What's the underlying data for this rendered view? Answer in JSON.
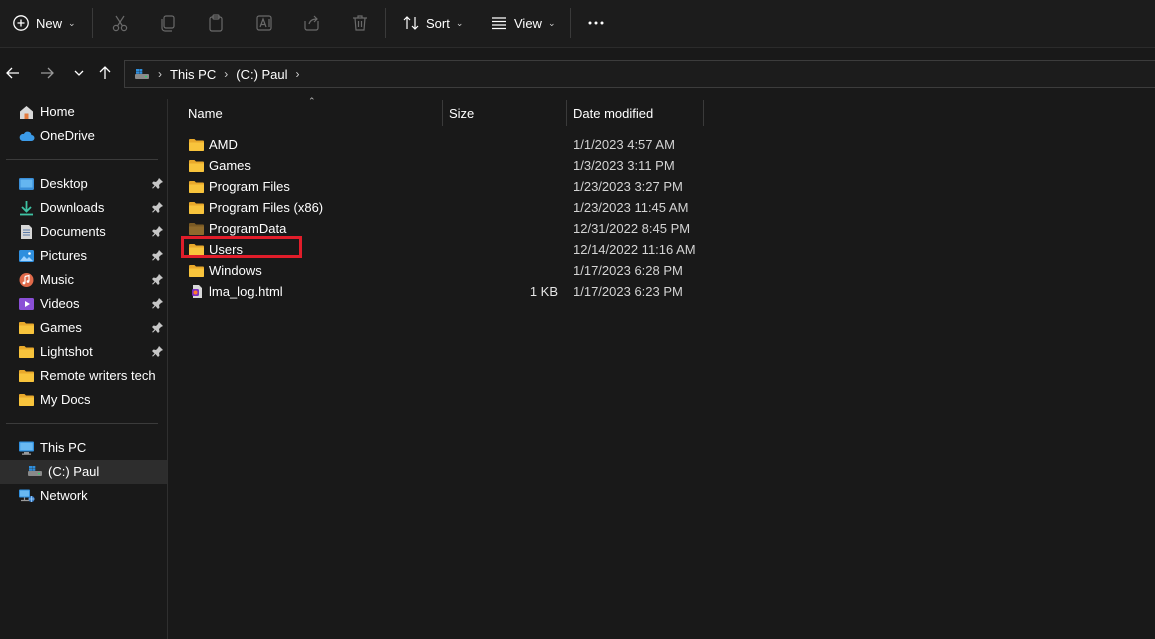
{
  "toolbar": {
    "new_label": "New",
    "sort_label": "Sort",
    "view_label": "View",
    "icons": [
      "new-icon",
      "cut-icon",
      "copy-icon",
      "paste-icon",
      "rename-icon",
      "share-icon",
      "delete-icon",
      "sort-icon",
      "view-icon",
      "more-icon"
    ]
  },
  "address": {
    "crumbs": [
      "This PC",
      "(C:) Paul"
    ]
  },
  "sidebar": {
    "items": [
      {
        "label": "Home",
        "icon": "home-icon"
      },
      {
        "label": "OneDrive",
        "icon": "cloud-icon"
      },
      {
        "label": "Desktop",
        "icon": "desktop-icon"
      },
      {
        "label": "Downloads",
        "icon": "download-icon"
      },
      {
        "label": "Documents",
        "icon": "document-icon"
      },
      {
        "label": "Pictures",
        "icon": "pictures-icon"
      },
      {
        "label": "Music",
        "icon": "music-icon"
      },
      {
        "label": "Videos",
        "icon": "videos-icon"
      },
      {
        "label": "Games",
        "icon": "folder-icon"
      },
      {
        "label": "Lightshot",
        "icon": "folder-icon"
      },
      {
        "label": "Remote writers tech",
        "icon": "folder-icon"
      },
      {
        "label": "My Docs",
        "icon": "folder-icon"
      },
      {
        "label": "This PC",
        "icon": "computer-icon"
      },
      {
        "label": "(C:) Paul",
        "icon": "drive-icon"
      },
      {
        "label": "Network",
        "icon": "network-icon"
      }
    ]
  },
  "columns": {
    "name": "Name",
    "size": "Size",
    "date": "Date modified"
  },
  "files": [
    {
      "name": "AMD",
      "size": "",
      "date": "1/1/2023 4:57 AM",
      "type": "folder"
    },
    {
      "name": "Games",
      "size": "",
      "date": "1/3/2023 3:11 PM",
      "type": "folder"
    },
    {
      "name": "Program Files",
      "size": "",
      "date": "1/23/2023 3:27 PM",
      "type": "folder"
    },
    {
      "name": "Program Files (x86)",
      "size": "",
      "date": "1/23/2023 11:45 AM",
      "type": "folder"
    },
    {
      "name": "ProgramData",
      "size": "",
      "date": "12/31/2022 8:45 PM",
      "type": "folder-hidden"
    },
    {
      "name": "Users",
      "size": "",
      "date": "12/14/2022 11:16 AM",
      "type": "folder"
    },
    {
      "name": "Windows",
      "size": "",
      "date": "1/17/2023 6:28 PM",
      "type": "folder"
    },
    {
      "name": "lma_log.html",
      "size": "1 KB",
      "date": "1/17/2023 6:23 PM",
      "type": "html-file"
    }
  ],
  "colors": {
    "background": "#191919",
    "folder": "#f8c43c",
    "highlight": "#e11d2a",
    "selected": "#2d2d2d"
  }
}
